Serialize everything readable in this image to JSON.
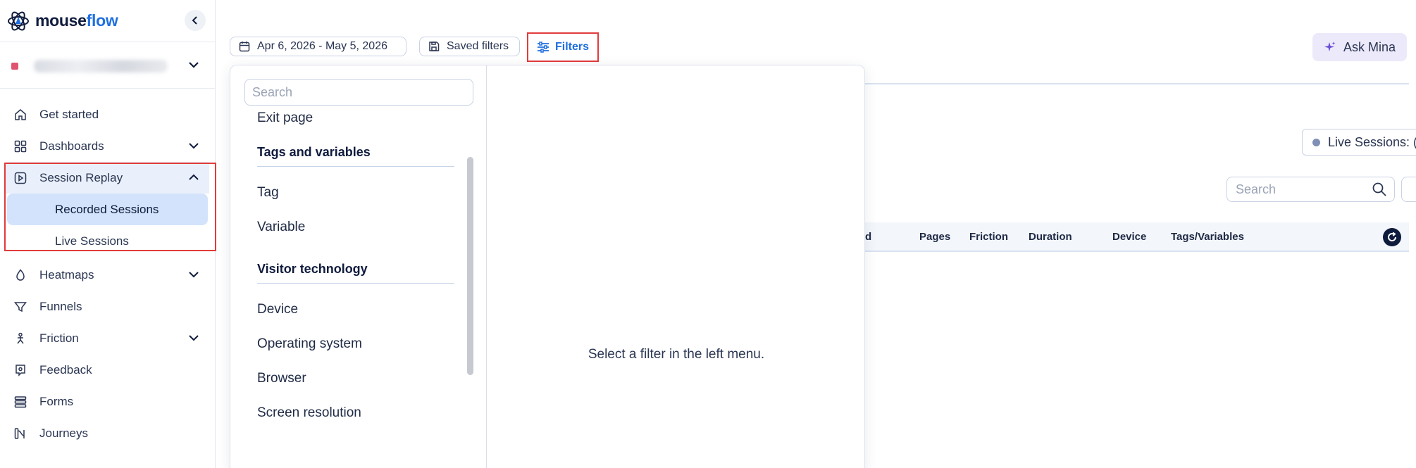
{
  "app": {
    "logo_prefix": "mouse",
    "logo_suffix": "flow",
    "brand_color": "#1f6fe0"
  },
  "sidebar": {
    "items": [
      {
        "label": "Get started",
        "icon": "home-icon"
      },
      {
        "label": "Dashboards",
        "icon": "dashboard-icon",
        "expandable": true
      },
      {
        "label": "Session Replay",
        "icon": "play-icon",
        "expanded": true
      },
      {
        "label": "Heatmaps",
        "icon": "flame-icon",
        "expandable": true
      },
      {
        "label": "Funnels",
        "icon": "funnel-icon"
      },
      {
        "label": "Friction",
        "icon": "friction-icon",
        "expandable": true
      },
      {
        "label": "Feedback",
        "icon": "feedback-icon"
      },
      {
        "label": "Forms",
        "icon": "forms-icon"
      },
      {
        "label": "Journeys",
        "icon": "journeys-icon"
      }
    ],
    "session_replay_sub": [
      {
        "label": "Recorded Sessions",
        "selected": true
      },
      {
        "label": "Live Sessions"
      }
    ]
  },
  "toolbar": {
    "date_range": "Apr 6, 2026 - May 5, 2026",
    "saved_filters": "Saved filters",
    "filters": "Filters",
    "ask_mina": "Ask Mina"
  },
  "live": {
    "label": "Live Sessions: (",
    "dot_color": "#7f8fb6"
  },
  "table": {
    "search_placeholder": "Search",
    "columns": [
      "d",
      "Pages",
      "Friction",
      "Duration",
      "Device",
      "Tags/Variables"
    ]
  },
  "filter_panel": {
    "search_placeholder": "Search",
    "top_item": "Exit page",
    "groups": [
      {
        "heading": "Tags and variables",
        "items": [
          "Tag",
          "Variable"
        ]
      },
      {
        "heading": "Visitor technology",
        "items": [
          "Device",
          "Operating system",
          "Browser",
          "Screen resolution"
        ]
      }
    ],
    "empty_message": "Select a filter in the left menu."
  }
}
